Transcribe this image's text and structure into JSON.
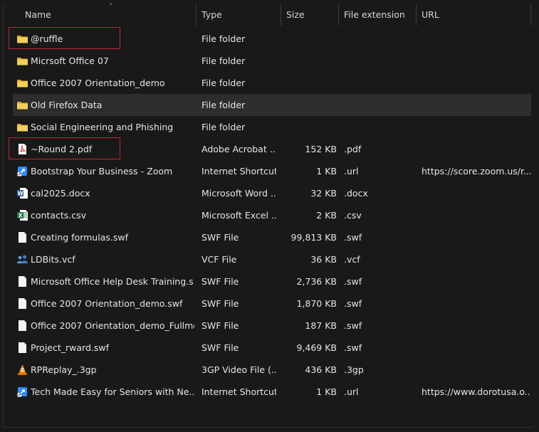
{
  "columns": {
    "name": "Name",
    "type": "Type",
    "size": "Size",
    "ext": "File extension",
    "url": "URL"
  },
  "rows": [
    {
      "icon": "folder-icon",
      "name": "@ruffle",
      "type": "File folder",
      "size": "",
      "ext": "",
      "url": "",
      "highlight": true
    },
    {
      "icon": "folder-icon",
      "name": "Micrsoft Office 07",
      "type": "File folder",
      "size": "",
      "ext": "",
      "url": ""
    },
    {
      "icon": "folder-icon",
      "name": "Office 2007 Orientation_demo",
      "type": "File folder",
      "size": "",
      "ext": "",
      "url": ""
    },
    {
      "icon": "folder-icon",
      "name": "Old Firefox Data",
      "type": "File folder",
      "size": "",
      "ext": "",
      "url": "",
      "hover": true
    },
    {
      "icon": "folder-icon",
      "name": "Social Engineering and Phishing",
      "type": "File folder",
      "size": "",
      "ext": "",
      "url": ""
    },
    {
      "icon": "pdf-icon",
      "name": "~Round 2.pdf",
      "type": "Adobe Acrobat ...",
      "size": "152 KB",
      "ext": ".pdf",
      "url": "",
      "highlight": true
    },
    {
      "icon": "shortcut-icon",
      "name": "Bootstrap Your Business - Zoom",
      "type": "Internet Shortcut",
      "size": "1 KB",
      "ext": ".url",
      "url": "https://score.zoom.us/r..."
    },
    {
      "icon": "word-icon",
      "name": "cal2025.docx",
      "type": "Microsoft Word ...",
      "size": "32 KB",
      "ext": ".docx",
      "url": ""
    },
    {
      "icon": "excel-icon",
      "name": "contacts.csv",
      "type": "Microsoft Excel ...",
      "size": "2 KB",
      "ext": ".csv",
      "url": ""
    },
    {
      "icon": "file-icon",
      "name": "Creating formulas.swf",
      "type": "SWF File",
      "size": "99,813 KB",
      "ext": ".swf",
      "url": ""
    },
    {
      "icon": "contact-icon",
      "name": "LDBits.vcf",
      "type": "VCF File",
      "size": "36 KB",
      "ext": ".vcf",
      "url": ""
    },
    {
      "icon": "file-icon",
      "name": "Microsoft Office Help Desk Training.s...",
      "type": "SWF File",
      "size": "2,736 KB",
      "ext": ".swf",
      "url": ""
    },
    {
      "icon": "file-icon",
      "name": "Office 2007 Orientation_demo.swf",
      "type": "SWF File",
      "size": "1,870 KB",
      "ext": ".swf",
      "url": ""
    },
    {
      "icon": "file-icon",
      "name": "Office 2007 Orientation_demo_Fullmo...",
      "type": "SWF File",
      "size": "187 KB",
      "ext": ".swf",
      "url": ""
    },
    {
      "icon": "file-icon",
      "name": "Project_rward.swf",
      "type": "SWF File",
      "size": "9,469 KB",
      "ext": ".swf",
      "url": ""
    },
    {
      "icon": "vlc-icon",
      "name": "RPReplay_.3gp",
      "type": "3GP Video File (...",
      "size": "436 KB",
      "ext": ".3gp",
      "url": ""
    },
    {
      "icon": "shortcut-icon",
      "name": "Tech Made Easy for Seniors with Ne...",
      "type": "Internet Shortcut",
      "size": "1 KB",
      "ext": ".url",
      "url": "https://www.dorotusa.o..."
    }
  ],
  "colors": {
    "background": "#191919",
    "hover_row": "#2d2d2d",
    "highlight_box": "#c0262c",
    "folder": "#f2c94c"
  }
}
